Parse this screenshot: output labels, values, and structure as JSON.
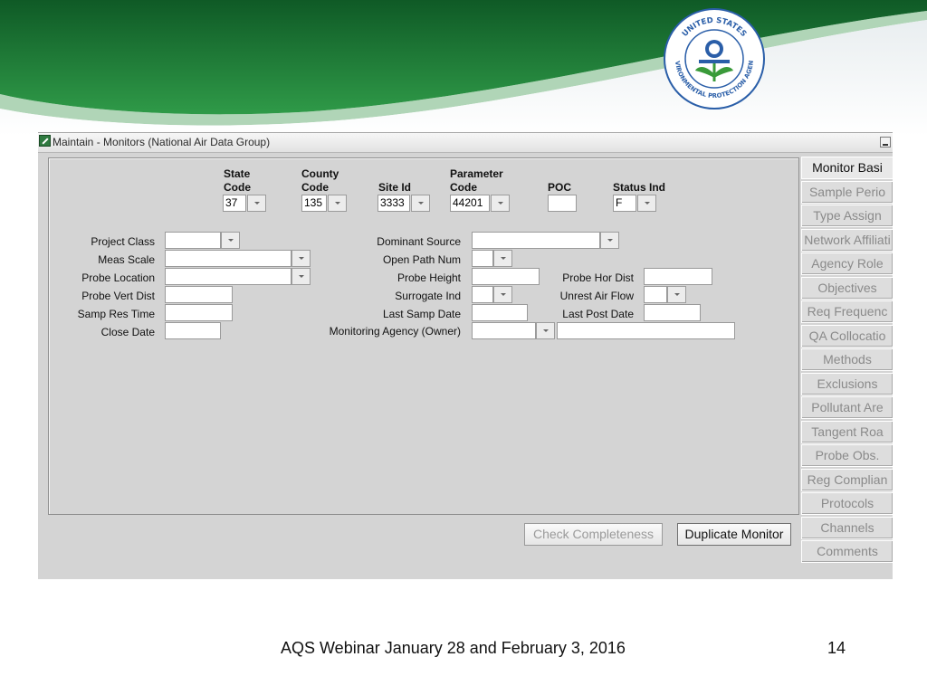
{
  "window": {
    "title": "Maintain - Monitors (National Air Data Group)"
  },
  "header_fields": {
    "state_code": {
      "label_line1": "State",
      "label_line2": "Code",
      "value": "37"
    },
    "county_code": {
      "label_line1": "County",
      "label_line2": "Code",
      "value": "135"
    },
    "site_id": {
      "label": "Site Id",
      "value": "3333"
    },
    "parameter_code": {
      "label_line1": "Parameter",
      "label_line2": "Code",
      "value": "44201"
    },
    "poc": {
      "label": "POC",
      "value": ""
    },
    "status_ind": {
      "label": "Status Ind",
      "value": "F"
    }
  },
  "left_fields": {
    "project_class": "Project Class",
    "meas_scale": "Meas Scale",
    "probe_location": "Probe Location",
    "probe_vert_dist": "Probe Vert Dist",
    "samp_res_time": "Samp Res Time",
    "close_date": "Close Date"
  },
  "middle_fields": {
    "dominant_source": "Dominant Source",
    "open_path_num": "Open Path Num",
    "probe_height": "Probe Height",
    "surrogate_ind": "Surrogate Ind",
    "last_samp_date": "Last Samp Date",
    "monitoring_agency": "Monitoring Agency (Owner)"
  },
  "right_fields": {
    "probe_hor_dist": "Probe Hor Dist",
    "unrest_air_flow": "Unrest Air Flow",
    "last_post_date": "Last Post Date"
  },
  "tabs": [
    {
      "label": "Monitor Basi",
      "active": true
    },
    {
      "label": "Sample Perio",
      "active": false
    },
    {
      "label": "Type Assign",
      "active": false
    },
    {
      "label": "Network Affiliati",
      "active": false
    },
    {
      "label": "Agency Role",
      "active": false
    },
    {
      "label": "Objectives",
      "active": false
    },
    {
      "label": "Req Frequenc",
      "active": false
    },
    {
      "label": "QA Collocatio",
      "active": false
    },
    {
      "label": "Methods",
      "active": false
    },
    {
      "label": "Exclusions",
      "active": false
    },
    {
      "label": "Pollutant Are",
      "active": false
    },
    {
      "label": "Tangent Roa",
      "active": false
    },
    {
      "label": "Probe Obs.",
      "active": false
    },
    {
      "label": "Reg Complian",
      "active": false
    },
    {
      "label": "Protocols",
      "active": false
    },
    {
      "label": "Channels",
      "active": false
    },
    {
      "label": "Comments",
      "active": false
    }
  ],
  "buttons": {
    "check_completeness": "Check Completeness",
    "duplicate_monitor": "Duplicate Monitor"
  },
  "footer": {
    "text": "AQS Webinar January 28 and February 3, 2016",
    "page_number": "14"
  },
  "logo": {
    "text_top": "UNITED STATES",
    "text_bottom": "ENVIRONMENTAL PROTECTION AGENCY"
  },
  "colors": {
    "banner_green": "#1f7a3a",
    "window_bg": "#d4d4d4"
  }
}
